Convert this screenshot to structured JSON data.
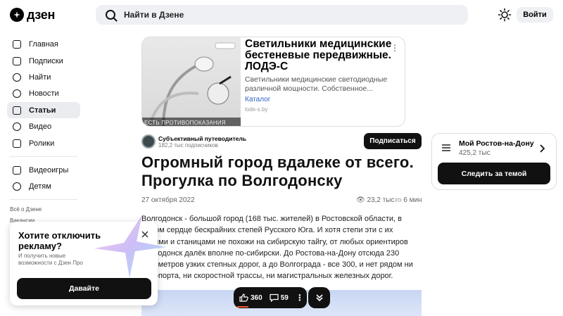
{
  "header": {
    "logo_text": "дзен",
    "search_placeholder": "Найти в Дзене",
    "login_label": "Войти"
  },
  "sidebar": {
    "items": [
      {
        "label": "Главная",
        "icon": "home-icon"
      },
      {
        "label": "Подписки",
        "icon": "subscriptions-icon"
      },
      {
        "label": "Найти",
        "icon": "search-icon"
      },
      {
        "label": "Новости",
        "icon": "news-icon"
      },
      {
        "label": "Статьи",
        "icon": "articles-icon",
        "active": true
      },
      {
        "label": "Видео",
        "icon": "video-icon"
      },
      {
        "label": "Ролики",
        "icon": "shorts-icon"
      },
      {
        "label": "Видеоигры",
        "icon": "gamepad-icon"
      },
      {
        "label": "Детям",
        "icon": "kids-icon"
      }
    ],
    "footer_links": [
      "Всё о Дзене",
      "Вакансии"
    ]
  },
  "ad": {
    "title": "Светильники медицинские бестеневые передвижные. ЛОДЭ-С",
    "description": "Светильники медицинские светодиодные различной мощности. Собственное...",
    "category": "Каталог",
    "domain": "lode-s.by",
    "warning": "ЕСТЬ ПРОТИВОПОКАЗАНИЯ"
  },
  "channel": {
    "name": "Субъективный путеводитель",
    "subscribers": "182,2 тыс подписчиков",
    "subscribe_label": "Подписаться"
  },
  "article": {
    "title": "Огромный город вдалеке от всего. Прогулка по Волгодонску",
    "date": "27 октября 2022",
    "views": "23,2 тыс",
    "read_time": "6 мин",
    "body": "Волгодонск - большой город (168 тыс. жителей) в Ростовской области, в самом сердце бескрайних степей Русского Юга. И хотя степи эти с их полями и станицами не похожи на сибирскую тайгу, от любых ориентиров Волгодонск далёк вполне по-сибирски. До Ростова-на-Дону отсюда 230 километров узких степных дорог, а до Волгограда - все 300, и нет рядом ни аэропорта, ни скоростной трассы, ни магистральных железных дорог."
  },
  "toolbar": {
    "likes": "360",
    "comments": "59"
  },
  "topic": {
    "name": "Мой Ростов-на-Дону",
    "subscribers": "425,2 тыс",
    "follow_label": "Следить за темой"
  },
  "popup": {
    "title": "Хотите отключить рекламу?",
    "subtitle": "И получить новые возможности с Дзен Про",
    "button_label": "Давайте"
  },
  "colors": {
    "accent": "#111111",
    "link": "#2a63c4",
    "progress": "#f2552c"
  }
}
